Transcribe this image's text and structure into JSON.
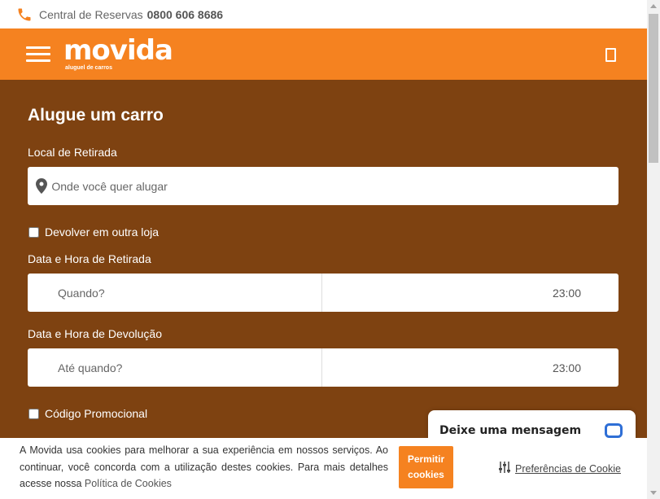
{
  "topbar": {
    "icon": "phone-icon",
    "label": "Central de Reservas",
    "phone": "0800 606 8686"
  },
  "header": {
    "logo_main": "movida",
    "logo_sub": "aluguel de carros",
    "menu_icon": "hamburger-icon",
    "right_icon": "account-icon"
  },
  "form": {
    "title": "Alugue um carro",
    "pickup_label": "Local de Retirada",
    "pickup_placeholder": "Onde você quer alugar",
    "pickup_value": "",
    "return_other_store_label": "Devolver em outra loja",
    "return_other_store_checked": false,
    "pickup_datetime_label": "Data e Hora de Retirada",
    "pickup_date_placeholder": "Quando?",
    "pickup_time": "23:00",
    "return_datetime_label": "Data e Hora de Devolução",
    "return_date_placeholder": "Até quando?",
    "return_time": "23:00",
    "promo_label": "Código Promocional",
    "promo_checked": false
  },
  "chat": {
    "label": "Deixe uma mensagem",
    "icon": "chat-icon"
  },
  "cookie": {
    "text": "A Movida usa cookies para melhorar a sua experiência em nossos serviços. Ao continuar, você concorda com a utilização destes cookies. Para mais detalhes acesse nossa",
    "policy_link": "Política de Cookies",
    "allow_button": "Permitir cookies",
    "preferences": "Preferências de Cookie",
    "preferences_icon": "sliders-icon"
  },
  "colors": {
    "brand_orange": "#f58220",
    "form_background": "#7e4211"
  }
}
